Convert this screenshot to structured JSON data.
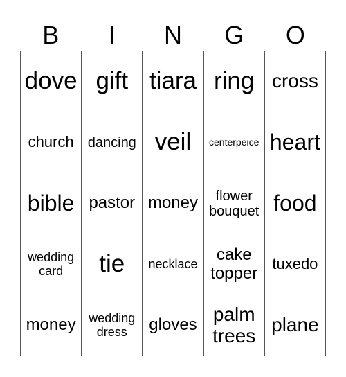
{
  "header": [
    "B",
    "I",
    "N",
    "G",
    "O"
  ],
  "cells": [
    [
      "dove",
      "gift",
      "tiara",
      "ring",
      "cross"
    ],
    [
      "church",
      "dancing",
      "veil",
      "centerpeice",
      "heart"
    ],
    [
      "bible",
      "pastor",
      "money",
      "flower bouquet",
      "food"
    ],
    [
      "wedding card",
      "tie",
      "necklace",
      "cake topper",
      "tuxedo"
    ],
    [
      "money",
      "wedding dress",
      "gloves",
      "palm trees",
      "plane"
    ]
  ]
}
